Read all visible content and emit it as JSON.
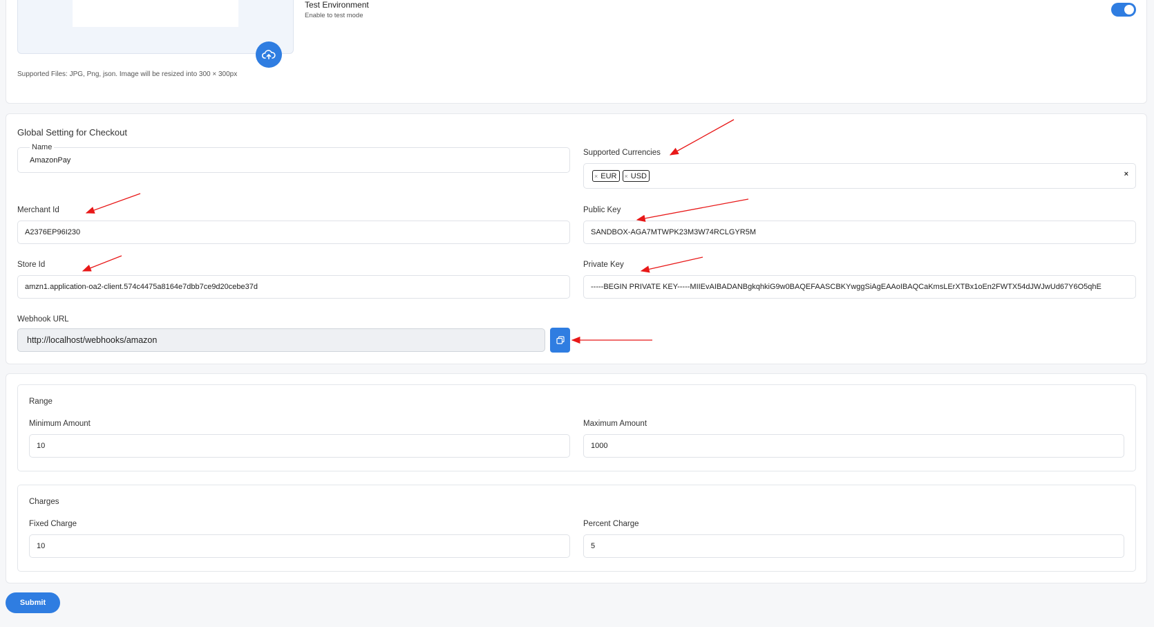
{
  "top": {
    "supported_files_note": "Supported Files: JPG, Png, json. Image will be resized into 300 × 300px",
    "test_env_title": "Test Environment",
    "test_env_sub": "Enable to test mode",
    "test_env_on": true
  },
  "checkout": {
    "title": "Global Setting for Checkout",
    "name_label": "Name",
    "name_value": "AmazonPay",
    "currencies_label": "Supported Currencies",
    "currencies": [
      "EUR",
      "USD"
    ],
    "tag_remove": "×",
    "clear_all": "×",
    "merchant_label": "Merchant Id",
    "merchant_value": "A2376EP96I230",
    "public_key_label": "Public Key",
    "public_key_value": "SANDBOX-AGA7MTWPK23M3W74RCLGYR5M",
    "store_label": "Store Id",
    "store_value": "amzn1.application-oa2-client.574c4475a8164e7dbb7ce9d20cebe37d",
    "private_key_label": "Private Key",
    "private_key_value": "-----BEGIN PRIVATE KEY-----MIIEvAIBADANBgkqhkiG9w0BAQEFAASCBKYwggSiAgEAAoIBAQCaKmsLErXTBx1oEn2FWTX54dJWJwUd67Y6O5qhE",
    "webhook_label": "Webhook URL",
    "webhook_value": "http://localhost/webhooks/amazon"
  },
  "range": {
    "title": "Range",
    "min_label": "Minimum Amount",
    "min_value": "10",
    "max_label": "Maximum Amount",
    "max_value": "1000"
  },
  "charges": {
    "title": "Charges",
    "fixed_label": "Fixed Charge",
    "fixed_value": "10",
    "percent_label": "Percent Charge",
    "percent_value": "5"
  },
  "submit_label": "Submit",
  "colors": {
    "accent": "#2f7de1",
    "arrow": "#e81818"
  },
  "icons": {
    "upload": "cloud-upload-icon",
    "copy": "copy-icon"
  }
}
